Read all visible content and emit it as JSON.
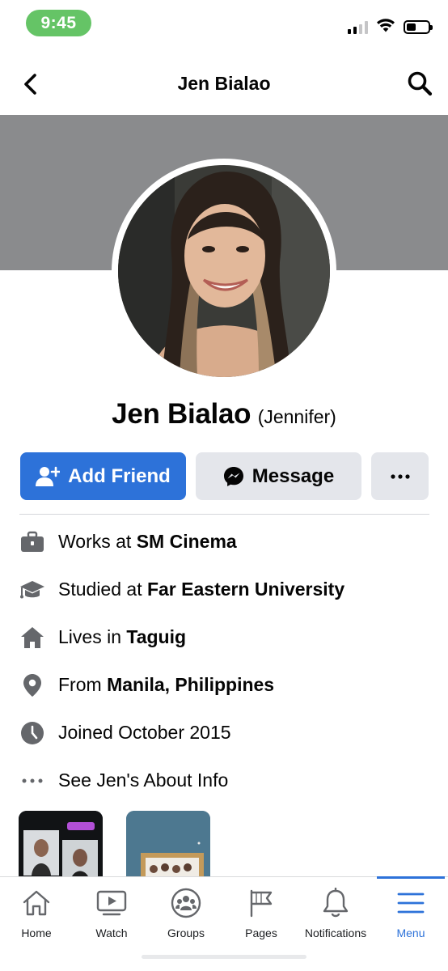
{
  "status_bar": {
    "time": "9:45",
    "battery_level": 0.45,
    "signal_bars": 2
  },
  "header": {
    "title": "Jen Bialao"
  },
  "profile": {
    "name": "Jen Bialao",
    "alternate_name": "(Jennifer)"
  },
  "actions": {
    "add_friend_label": "Add Friend",
    "message_label": "Message"
  },
  "about": {
    "work": {
      "prefix": "Works at ",
      "value": "SM Cinema"
    },
    "education": {
      "prefix": "Studied at ",
      "value": "Far Eastern University"
    },
    "lives": {
      "prefix": "Lives in ",
      "value": "Taguig"
    },
    "from": {
      "prefix": "From ",
      "value": "Manila, Philippines"
    },
    "joined": {
      "text": "Joined October 2015"
    },
    "see_about": {
      "text": "See Jen's About Info"
    }
  },
  "tabbar": {
    "items": [
      {
        "label": "Home",
        "icon": "home-icon"
      },
      {
        "label": "Watch",
        "icon": "watch-icon"
      },
      {
        "label": "Groups",
        "icon": "groups-icon"
      },
      {
        "label": "Pages",
        "icon": "flag-icon"
      },
      {
        "label": "Notifications",
        "icon": "bell-icon"
      },
      {
        "label": "Menu",
        "icon": "menu-icon",
        "active": true
      }
    ]
  },
  "colors": {
    "brand_blue": "#2d72d9",
    "cover_gray": "#8a8b8d",
    "button_gray": "#e4e6eb",
    "time_pill": "#65c466"
  }
}
